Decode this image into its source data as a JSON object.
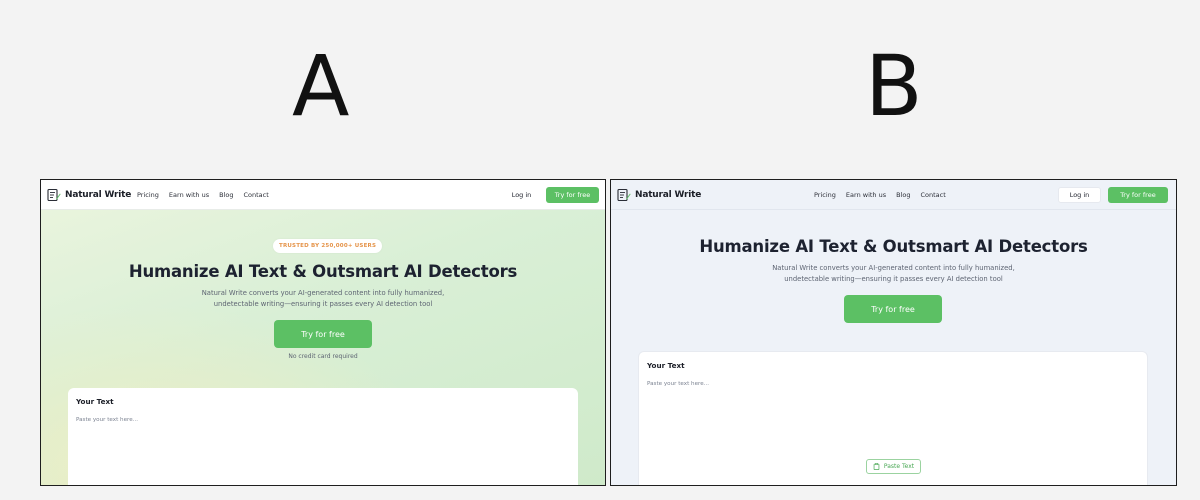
{
  "labels": {
    "a": "A",
    "b": "B"
  },
  "variant_a": {
    "logo": "Natural Write",
    "nav": [
      "Pricing",
      "Earn with us",
      "Blog",
      "Contact"
    ],
    "login": "Log in",
    "try_nav": "Try for free",
    "badge": "TRUSTED BY 250,000+ USERS",
    "title": "Humanize AI Text & Outsmart AI Detectors",
    "subtitle_line1": "Natural Write converts your AI-generated content into fully humanized,",
    "subtitle_line2": "undetectable writing—ensuring it passes every AI detection tool",
    "cta": "Try for free",
    "note": "No credit card required",
    "card_title": "Your Text",
    "placeholder": "Paste your text here..."
  },
  "variant_b": {
    "logo": "Natural Write",
    "nav": [
      "Pricing",
      "Earn with us",
      "Blog",
      "Contact"
    ],
    "login": "Log in",
    "try_nav": "Try for free",
    "title": "Humanize AI Text & Outsmart AI Detectors",
    "subtitle_line1": "Natural Write converts your AI-generated content into fully humanized,",
    "subtitle_line2": "undetectable writing—ensuring it passes every AI detection tool",
    "cta": "Try for free",
    "card_title": "Your Text",
    "placeholder": "Paste your text here...",
    "paste_button": "Paste Text"
  },
  "colors": {
    "brand_green": "#5cc064",
    "badge_orange": "#e5944a",
    "page_bg": "#f3f3f3",
    "b_bg": "#eef2f8"
  }
}
